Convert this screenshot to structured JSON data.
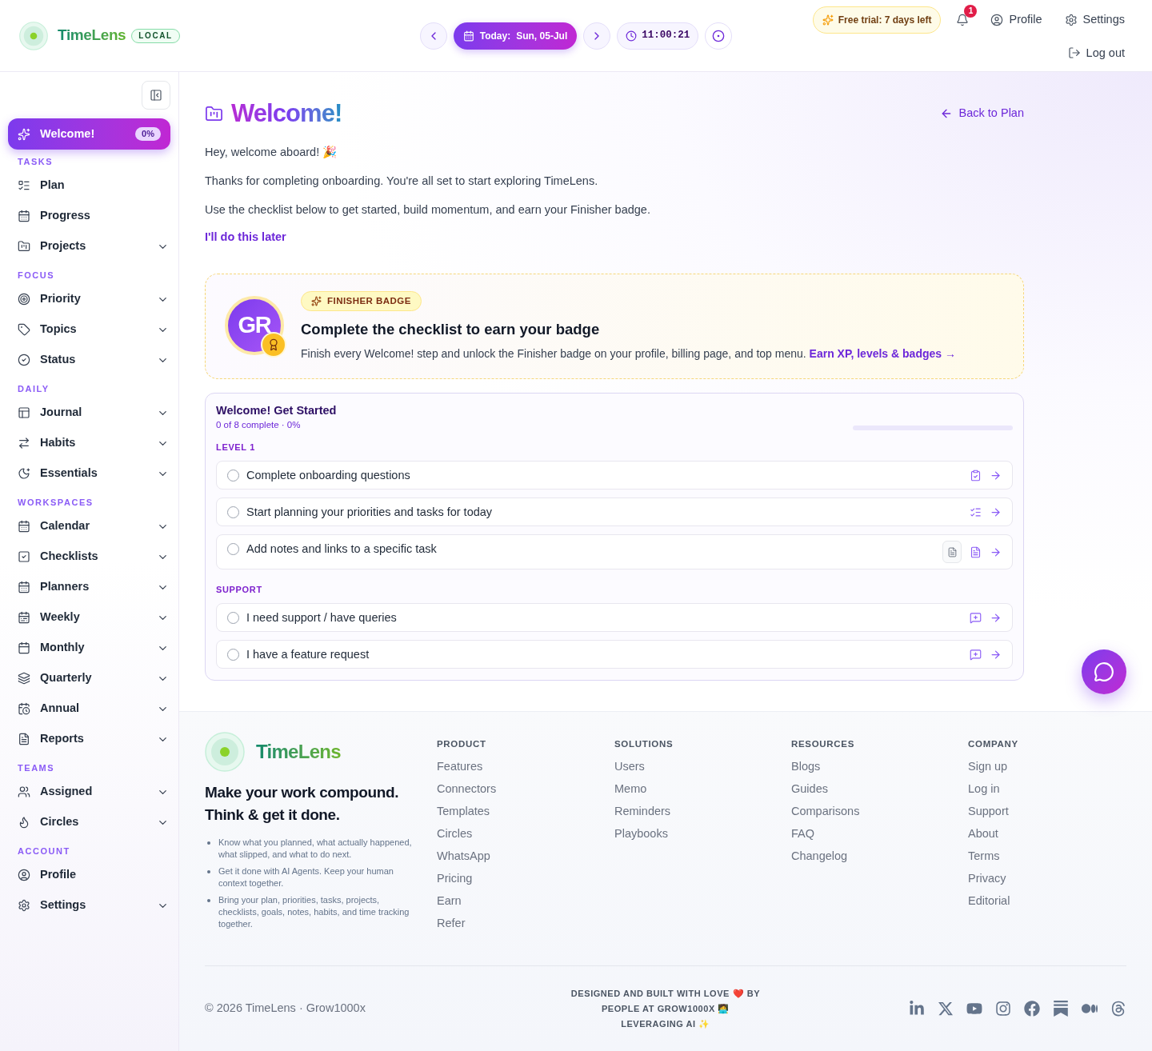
{
  "header": {
    "brand": {
      "name": "TimeLens",
      "tag": "LOCAL"
    },
    "date_nav": {
      "label": "Today:",
      "date": "Sun, 05-Jul"
    },
    "clock": "11:00:21",
    "trial": "Free trial: 7 days left",
    "notifications": "1",
    "links": [
      {
        "label": "Profile"
      },
      {
        "label": "Settings"
      }
    ],
    "logout": "Log out"
  },
  "sidebar": {
    "welcome": {
      "label": "Welcome!",
      "badge": "0%",
      "selected": true
    },
    "sections": [
      {
        "label": "TASKS",
        "items": [
          {
            "label": "Plan",
            "expandable": false,
            "selected": false
          },
          {
            "label": "Progress",
            "expandable": false,
            "selected": false
          },
          {
            "label": "Projects",
            "expandable": true,
            "selected": false
          }
        ]
      },
      {
        "label": "FOCUS",
        "items": [
          {
            "label": "Priority",
            "expandable": true,
            "selected": false
          },
          {
            "label": "Topics",
            "expandable": true,
            "selected": false
          },
          {
            "label": "Status",
            "expandable": true,
            "selected": false
          }
        ]
      },
      {
        "label": "DAILY",
        "items": [
          {
            "label": "Journal",
            "expandable": true,
            "selected": false
          },
          {
            "label": "Habits",
            "expandable": true,
            "selected": false
          },
          {
            "label": "Essentials",
            "expandable": true,
            "selected": false
          }
        ]
      },
      {
        "label": "WORKSPACES",
        "items": [
          {
            "label": "Calendar",
            "expandable": true,
            "selected": false
          },
          {
            "label": "Checklists",
            "expandable": true,
            "selected": false
          },
          {
            "label": "Planners",
            "expandable": true,
            "selected": false
          },
          {
            "label": "Weekly",
            "expandable": true,
            "selected": false
          },
          {
            "label": "Monthly",
            "expandable": true,
            "selected": false
          },
          {
            "label": "Quarterly",
            "expandable": true,
            "selected": false
          },
          {
            "label": "Annual",
            "expandable": true,
            "selected": false
          },
          {
            "label": "Reports",
            "expandable": true,
            "selected": false
          }
        ]
      },
      {
        "label": "TEAMS",
        "items": [
          {
            "label": "Assigned",
            "expandable": true,
            "selected": false
          },
          {
            "label": "Circles",
            "expandable": true,
            "selected": false
          }
        ]
      },
      {
        "label": "ACCOUNT",
        "items": [
          {
            "label": "Profile",
            "expandable": false,
            "selected": false
          },
          {
            "label": "Settings",
            "expandable": true,
            "selected": false
          }
        ]
      }
    ]
  },
  "page": {
    "title": "Welcome!",
    "back_link": "Back to Plan",
    "paragraphs": [
      "Hey, welcome aboard! 🎉",
      "Thanks for completing onboarding. You're all set to start exploring TimeLens.",
      "Use the checklist below to get started, build momentum, and earn your Finisher badge."
    ],
    "later_link": "I'll do this later"
  },
  "badge_card": {
    "initials": "GR",
    "tag": "FINISHER BADGE",
    "heading": "Complete the checklist to earn your badge",
    "text": "Finish every Welcome! step and unlock the Finisher badge on your profile, billing page, and top menu.",
    "link": "Earn XP, levels & badges →"
  },
  "checklist": {
    "title": "Welcome! Get Started",
    "summary": "0 of 8 complete · 0%",
    "progress": {
      "level": 0
    },
    "groups": [
      {
        "label": "LEVEL 1",
        "items": [
          {
            "label": "Complete onboarding questions",
            "checked": false
          },
          {
            "label": "Start planning your priorities and tasks for today",
            "checked": false
          },
          {
            "label": "Add notes and links to a specific task",
            "checked": false
          }
        ]
      },
      {
        "label": "SUPPORT",
        "items": [
          {
            "label": "I need support / have queries",
            "checked": false
          },
          {
            "label": "I have a feature request",
            "checked": false
          }
        ]
      }
    ]
  },
  "footer": {
    "brand": "TimeLens",
    "tagline": [
      "Make your work compound.",
      "Think & get it done."
    ],
    "bullets": [
      "Know what you planned, what actually happened, what slipped, and what to do next.",
      "Get it done with AI Agents. Keep your human context together.",
      "Bring your plan, priorities, tasks, projects, checklists, goals, notes, habits, and time tracking together."
    ],
    "columns": [
      {
        "heading": "PRODUCT",
        "links": [
          "Features",
          "Connectors",
          "Templates",
          "Circles",
          "WhatsApp",
          "Pricing",
          "Earn",
          "Refer"
        ]
      },
      {
        "heading": "SOLUTIONS",
        "links": [
          "Users",
          "Memo",
          "Reminders",
          "Playbooks"
        ]
      },
      {
        "heading": "RESOURCES",
        "links": [
          "Blogs",
          "Guides",
          "Comparisons",
          "FAQ",
          "Changelog"
        ]
      },
      {
        "heading": "COMPANY",
        "links": [
          "Sign up",
          "Log in",
          "Support",
          "About",
          "Terms",
          "Privacy",
          "Editorial"
        ]
      }
    ],
    "copyright": "© 2026 TimeLens · Grow1000x",
    "credit": [
      "DESIGNED AND BUILT WITH LOVE ❤️ BY",
      "PEOPLE AT GROW1000X 🧑‍💻",
      "LEVERAGING AI ✨"
    ]
  }
}
